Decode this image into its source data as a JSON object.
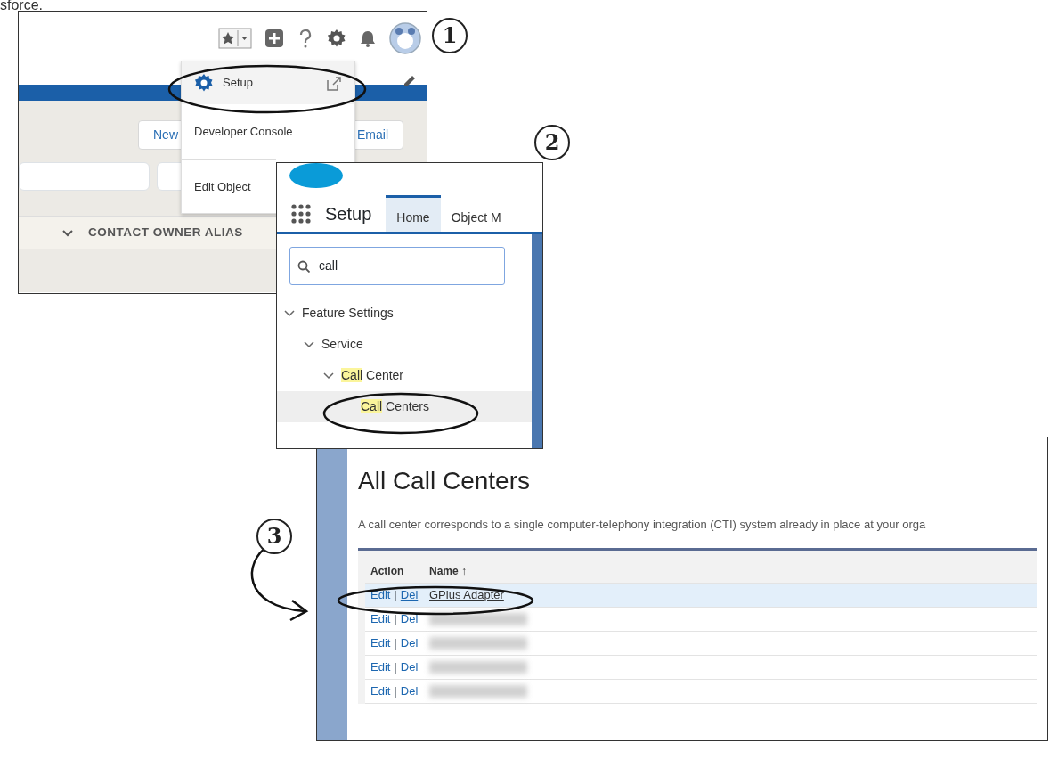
{
  "caption_fragment": "sforce.",
  "panel_1": {
    "callout": "1",
    "menu": [
      {
        "label": "Setup",
        "kind": "setup",
        "circled": true
      },
      {
        "label": "Developer Console",
        "kind": "plain",
        "circled": false
      },
      {
        "label": "Edit Object",
        "kind": "plain",
        "circled": false
      }
    ],
    "buttons": [
      "New",
      "Email"
    ],
    "column_header": "CONTACT OWNER ALIAS"
  },
  "panel_2": {
    "callout": "2",
    "app_title": "Setup",
    "tabs": [
      {
        "label": "Home",
        "selected": true
      },
      {
        "label": "Object M",
        "selected": false
      }
    ],
    "search": {
      "value": "call"
    },
    "tree": [
      {
        "parts": [
          {
            "text": "Feature Settings",
            "highlighted": false
          }
        ],
        "expanded": true,
        "selected": false,
        "circled": false,
        "children": [
          {
            "parts": [
              {
                "text": "Service",
                "highlighted": false
              }
            ],
            "expanded": true,
            "selected": false,
            "circled": false,
            "children": [
              {
                "parts": [
                  {
                    "text": "Call",
                    "highlighted": true
                  },
                  {
                    "text": " Center",
                    "highlighted": false
                  }
                ],
                "expanded": true,
                "selected": false,
                "circled": false,
                "children": [
                  {
                    "parts": [
                      {
                        "text": "Call",
                        "highlighted": true
                      },
                      {
                        "text": " Centers",
                        "highlighted": false
                      }
                    ],
                    "selected": true,
                    "circled": true
                  }
                ]
              }
            ]
          }
        ]
      }
    ]
  },
  "panel_3": {
    "callout": "3",
    "title": "All Call Centers",
    "description": "A call center corresponds to a single computer-telephony integration (CTI) system already in place at your orga",
    "columns": [
      "Action",
      "Name ↑"
    ],
    "rows": [
      {
        "actions": [
          "Edit",
          "Del"
        ],
        "separator": "|",
        "name": "GPlus Adapter",
        "selected": true,
        "circled": true
      },
      {
        "actions": [
          "Edit",
          "Del"
        ],
        "separator": "|",
        "selected": false,
        "circled": false
      },
      {
        "actions": [
          "Edit",
          "Del"
        ],
        "separator": "|",
        "selected": false,
        "circled": false
      },
      {
        "actions": [
          "Edit",
          "Del"
        ],
        "separator": "|",
        "selected": false,
        "circled": false
      },
      {
        "actions": [
          "Edit",
          "Del"
        ],
        "separator": "|",
        "selected": false,
        "circled": false
      }
    ]
  }
}
